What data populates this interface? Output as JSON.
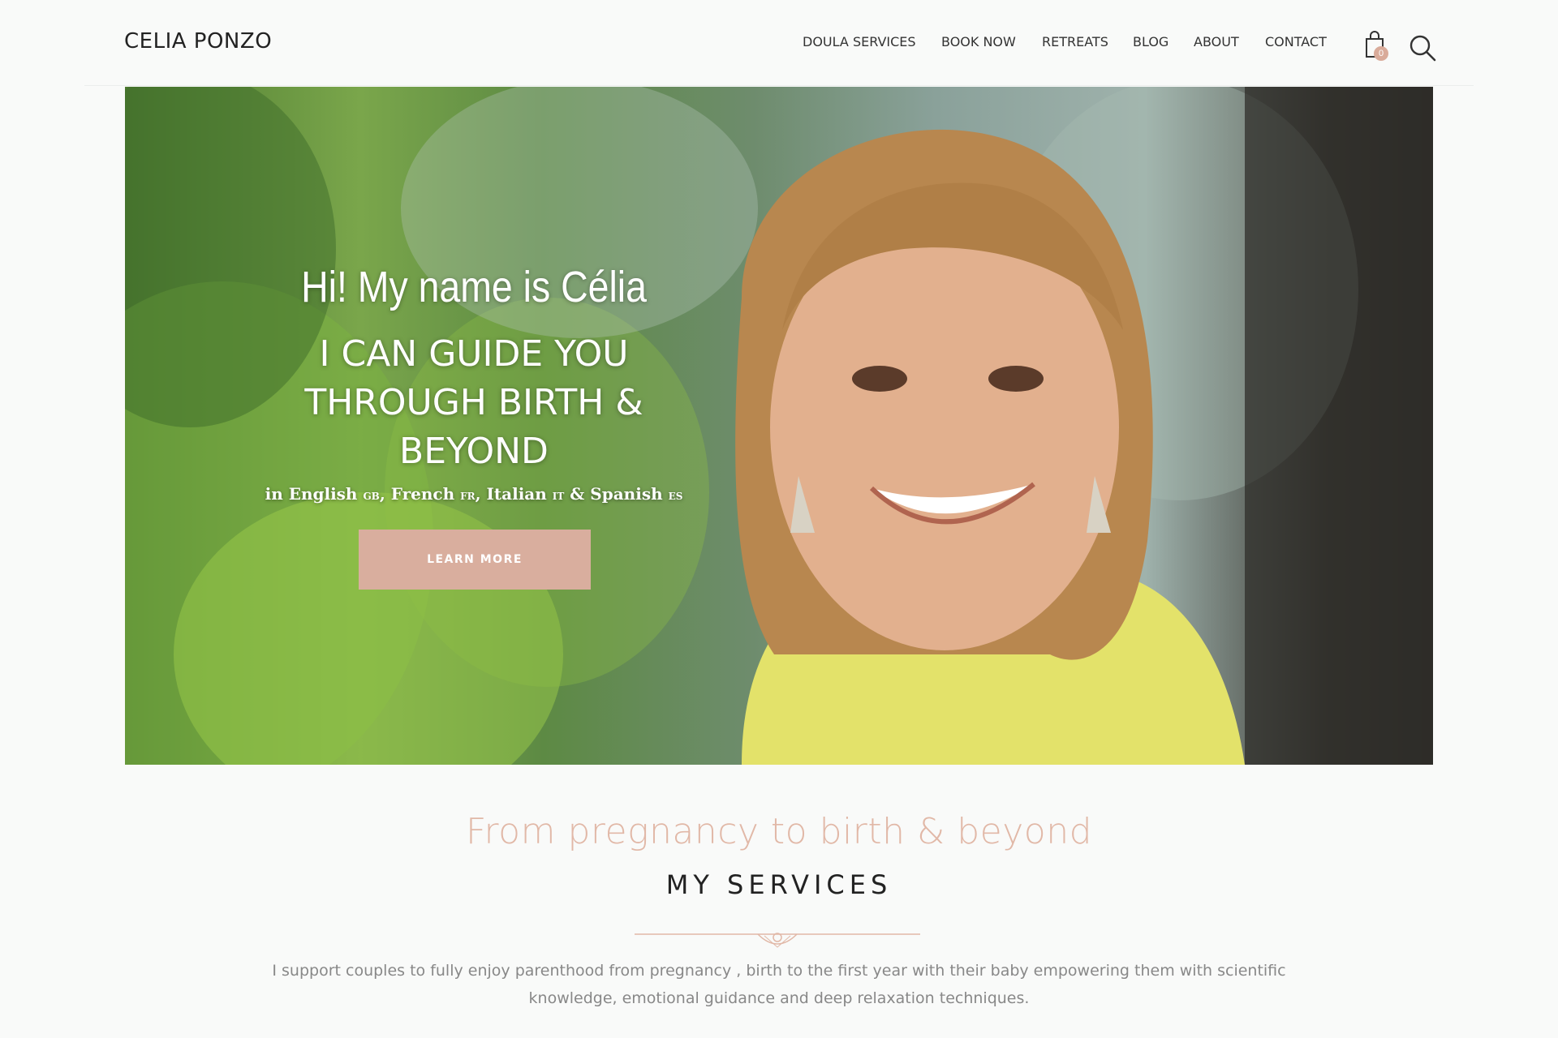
{
  "site": {
    "logo": "CELIA PONZO"
  },
  "nav": {
    "items": [
      "DOULA SERVICES",
      "BOOK NOW",
      "RETREATS",
      "BLOG",
      "ABOUT",
      "CONTACT"
    ],
    "cart_count": "0",
    "cart_icon": "shopping-bag-icon",
    "search_icon": "search-icon"
  },
  "hero": {
    "greeting": "Hi! My name is Célia",
    "headline_lines": [
      "I CAN GUIDE YOU",
      "THROUGH BIRTH &",
      "BEYOND"
    ],
    "languages": {
      "prefix": "in",
      "items": [
        {
          "name": "English",
          "code": "GB"
        },
        {
          "name": "French",
          "code": "FR"
        },
        {
          "name": "Italian",
          "code": "IT"
        },
        {
          "name": "Spanish",
          "code": "ES"
        }
      ]
    },
    "button_label": "LEARN MORE"
  },
  "services": {
    "tagline": "From pregnancy to birth & beyond",
    "title": "MY SERVICES",
    "intro": "I support couples to fully enjoy parenthood from pregnancy , birth to the first year with their baby empowering them with  scientific knowledge, emotional guidance and deep relaxation techniques."
  },
  "colors": {
    "accent": "#d9ae9e",
    "tagline": "#e1b8a7",
    "background": "#f9faf9"
  }
}
